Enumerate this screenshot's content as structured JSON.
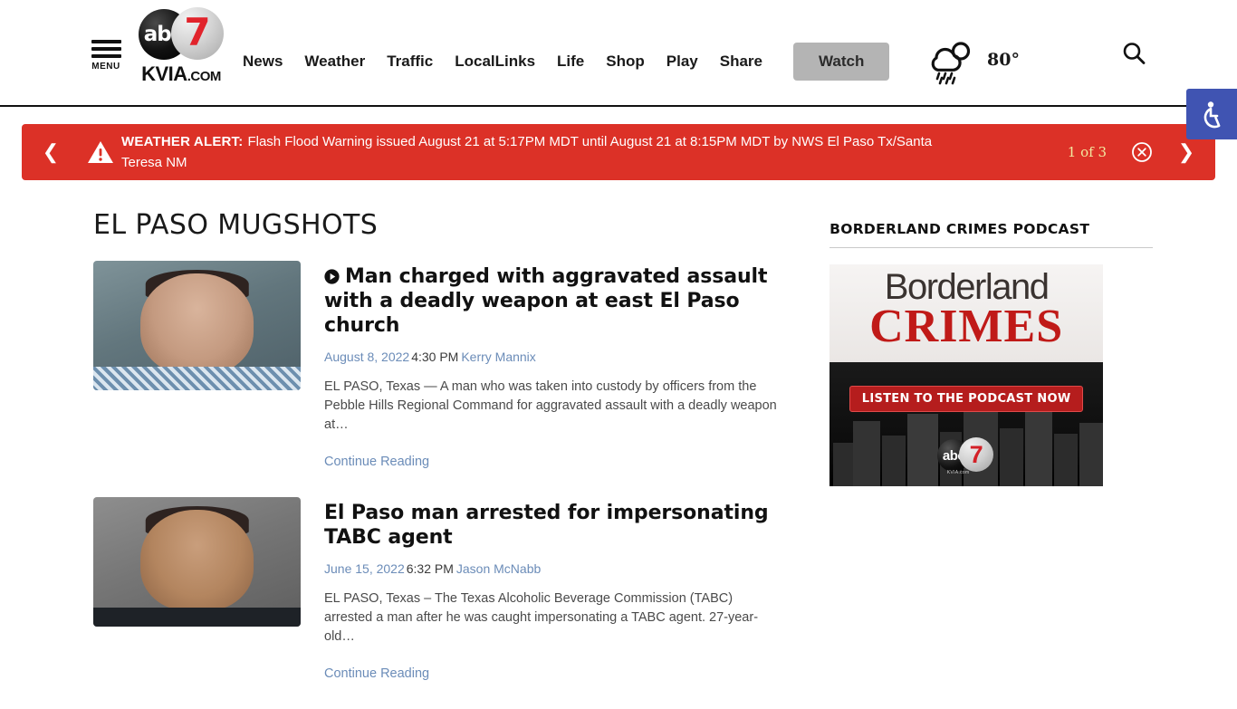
{
  "header": {
    "menu_label": "MENU",
    "logo": {
      "abc": "abc",
      "seven": "7",
      "wordmark": "KVIA",
      "wordmark_suffix": ".COM"
    },
    "nav_items": [
      {
        "label": "News"
      },
      {
        "label": "Weather"
      },
      {
        "label": "Traffic"
      },
      {
        "label": "LocalLinks"
      },
      {
        "label": "Life"
      },
      {
        "label": "Shop"
      },
      {
        "label": "Play"
      },
      {
        "label": "Share"
      }
    ],
    "watch_label": "Watch",
    "weather": {
      "icon": "rain-cloud-icon",
      "temperature": "80°"
    },
    "search_icon": "search-icon",
    "accessibility_icon": "accessibility-icon"
  },
  "alert": {
    "prev_icon": "chevron-left-icon",
    "next_icon": "chevron-right-icon",
    "warning_icon": "warning-triangle-icon",
    "label": "WEATHER ALERT:",
    "message": "Flash Flood Warning issued August 21 at 5:17PM MDT until August 21 at 8:15PM MDT by NWS El Paso Tx/Santa Teresa NM",
    "counter": "1 of 3",
    "close_icon": "close-circle-icon",
    "background_color": "#dc3127"
  },
  "main": {
    "page_title": "EL PASO MUGSHOTS",
    "articles": [
      {
        "has_video": true,
        "video_icon": "play-circle-icon",
        "thumb_alt": "mugshot-photo",
        "headline": "Man charged with aggravated assault with a deadly weapon at east El Paso church",
        "date": "August 8, 2022",
        "time": "4:30 PM",
        "author": "Kerry Mannix",
        "excerpt": "EL PASO, Texas — A man who was taken into custody by officers from the Pebble Hills Regional Command for aggravated assault with a deadly weapon at…",
        "continue_label": "Continue Reading"
      },
      {
        "has_video": false,
        "video_icon": "",
        "thumb_alt": "mugshot-photo",
        "headline": "El Paso man arrested for impersonating TABC agent",
        "date": "June 15, 2022",
        "time": "6:32 PM",
        "author": "Jason McNabb",
        "excerpt": "EL PASO, Texas – The Texas Alcoholic Beverage Commission (TABC) arrested a man after he was caught impersonating a TABC agent. 27-year-old…",
        "continue_label": "Continue Reading"
      }
    ]
  },
  "sidebar": {
    "podcast_heading": "BORDERLAND CRIMES PODCAST",
    "podcast": {
      "title_line1": "Borderland",
      "title_line2": "CRIMES",
      "cta": "LISTEN TO THE PODCAST NOW",
      "logo_abc": "abc",
      "logo_seven": "7",
      "logo_caption": "KVIA.com"
    }
  }
}
